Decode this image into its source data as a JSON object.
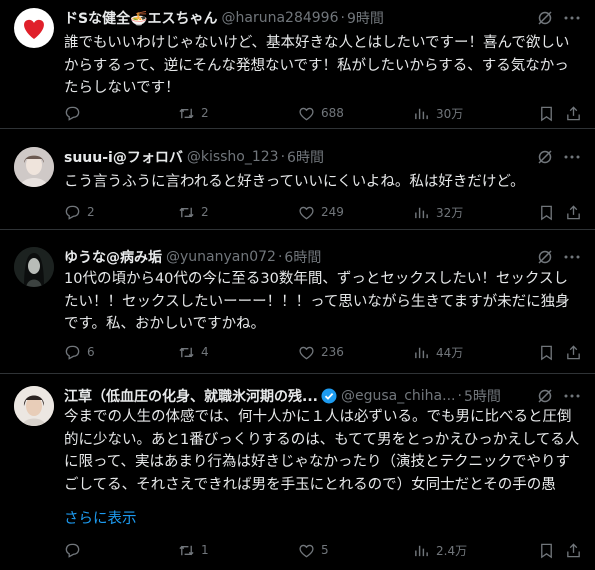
{
  "tweets": [
    {
      "name": "ドSな健全🍜エスちゃん",
      "handle": "@haruna284996",
      "time": "9時間",
      "text": "誰でもいいわけじゃないけど、基本好きな人とはしたいですー！喜んで欲しいからするって、逆にそんな発想ないです！私がしたいからする、する気なかったらしないです！",
      "replies": "",
      "retweets": "2",
      "likes": "688",
      "views": "30万"
    },
    {
      "name": "suuu-i@フォロバ",
      "handle": "@kissho_123",
      "time": "6時間",
      "text": "こう言うふうに言われると好きっていいにくいよね。私は好きだけど。",
      "replies": "2",
      "retweets": "2",
      "likes": "249",
      "views": "32万"
    },
    {
      "name": "ゆうな@病み垢",
      "handle": "@yunanyan072",
      "time": "6時間",
      "text": "10代の頃から40代の今に至る30数年間、ずっとセックスしたい！セックスしたい！！セックスしたいーーー！！！って思いながら生きてますが未だに独身です。私、おかしいですかね。",
      "replies": "6",
      "retweets": "4",
      "likes": "236",
      "views": "44万"
    },
    {
      "name": "江草（低血圧の化身、就職氷河期の残...",
      "handle": "@egusa_chiha...",
      "time": "5時間",
      "text": "今までの人生の体感では、何十人かに１人は必ずいる。でも男に比べると圧倒的に少ない。あと1番びっくりするのは、もてて男をとっかえひっかえしてる人に限って、実はあまり行為は好きじゃなかったり（演技とテクニックでやりすごしてる、それさえできれば男を手玉にとれるので）女同士だとその手の愚",
      "show_more": "さらに表示",
      "replies": "",
      "retweets": "1",
      "likes": "5",
      "views": "2.4万"
    }
  ],
  "dot": "·",
  "colors": {
    "background": "#000000",
    "text": "#e7e9ea",
    "muted": "#71767b",
    "link": "#1d9bf0",
    "divider": "#2f3336"
  },
  "icons": [
    "grok-icon",
    "more-icon",
    "reply-icon",
    "retweet-icon",
    "like-icon",
    "views-icon",
    "bookmark-icon",
    "share-icon",
    "verified-icon"
  ]
}
